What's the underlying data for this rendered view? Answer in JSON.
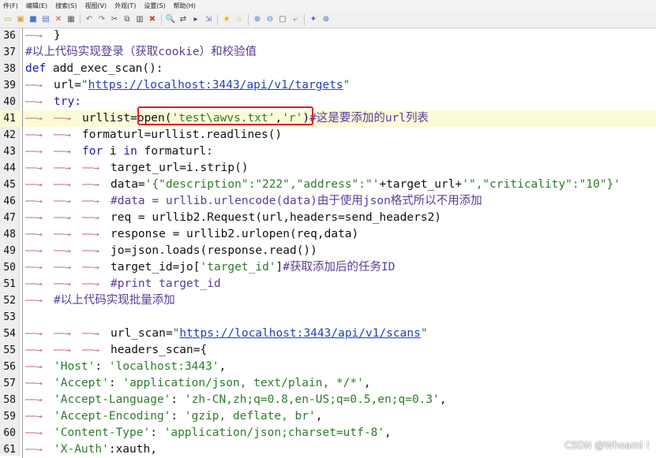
{
  "menubar": {
    "items": [
      "件(F)",
      "编辑(E)",
      "搜索(S)",
      "视图(V)",
      "外观(T)",
      "设置(S)",
      "帮助(H)"
    ]
  },
  "toolbar": {
    "icons": [
      "new-icon",
      "open-icon",
      "save-icon",
      "saveall-icon",
      "close-icon",
      "print-icon",
      "undo-icon",
      "redo-icon",
      "cut-icon",
      "copy-icon",
      "paste-icon",
      "delete-icon",
      "find-icon",
      "replace-icon",
      "findnext-icon",
      "goto-icon",
      "bookmark-icon",
      "bookmark-next-icon",
      "zoom-in-icon",
      "zoom-out-icon",
      "fullscreen-icon",
      "wrap-icon",
      "pin-icon",
      "plugin-icon"
    ]
  },
  "editor": {
    "lines": [
      {
        "n": "36",
        "segs": [
          {
            "t": "↦",
            "c": "tab"
          },
          {
            "t": "}",
            "c": ""
          }
        ]
      },
      {
        "n": "37",
        "segs": [
          {
            "t": "#以上代码实现登录（获取cookie）和校验值",
            "c": "cm"
          }
        ]
      },
      {
        "n": "38",
        "segs": [
          {
            "t": "def ",
            "c": "def"
          },
          {
            "t": "add_exec_scan():",
            "c": ""
          }
        ]
      },
      {
        "n": "39",
        "segs": [
          {
            "t": "↦",
            "c": "tab"
          },
          {
            "t": "url=",
            "c": ""
          },
          {
            "t": "\"",
            "c": "str"
          },
          {
            "t": "https://localhost:3443/api/v1/targets",
            "c": "url"
          },
          {
            "t": "\"",
            "c": "str"
          }
        ]
      },
      {
        "n": "40",
        "segs": [
          {
            "t": "↦",
            "c": "tab"
          },
          {
            "t": "try:",
            "c": "kw"
          }
        ]
      },
      {
        "n": "41",
        "segs": [
          {
            "t": "↦",
            "c": "tab"
          },
          {
            "t": "↦",
            "c": "tab"
          },
          {
            "t": "urllist=open(",
            "c": ""
          },
          {
            "t": "'test\\awvs.txt'",
            "c": "str"
          },
          {
            "t": ",",
            "c": ""
          },
          {
            "t": "'r'",
            "c": "str"
          },
          {
            "t": ")",
            "c": ""
          },
          {
            "t": "#这是要添加的url列表",
            "c": "cm"
          }
        ]
      },
      {
        "n": "42",
        "segs": [
          {
            "t": "↦",
            "c": "tab"
          },
          {
            "t": "↦",
            "c": "tab"
          },
          {
            "t": "formaturl=urllist.readlines()",
            "c": ""
          }
        ]
      },
      {
        "n": "43",
        "segs": [
          {
            "t": "↦",
            "c": "tab"
          },
          {
            "t": "↦",
            "c": "tab"
          },
          {
            "t": "for ",
            "c": "kw"
          },
          {
            "t": "i ",
            "c": ""
          },
          {
            "t": "in ",
            "c": "kw"
          },
          {
            "t": "formaturl:",
            "c": ""
          }
        ]
      },
      {
        "n": "44",
        "segs": [
          {
            "t": "↦",
            "c": "tab"
          },
          {
            "t": "↦",
            "c": "tab"
          },
          {
            "t": "↦",
            "c": "tab"
          },
          {
            "t": "target_url=i.strip()",
            "c": ""
          }
        ]
      },
      {
        "n": "45",
        "segs": [
          {
            "t": "↦",
            "c": "tab"
          },
          {
            "t": "↦",
            "c": "tab"
          },
          {
            "t": "↦",
            "c": "tab"
          },
          {
            "t": "data=",
            "c": ""
          },
          {
            "t": "'{\"description\":\"222\",\"address\":\"'",
            "c": "str"
          },
          {
            "t": "+target_url+",
            "c": ""
          },
          {
            "t": "'\",\"criticality\":\"10\"}'",
            "c": "str"
          }
        ]
      },
      {
        "n": "46",
        "segs": [
          {
            "t": "↦",
            "c": "tab"
          },
          {
            "t": "↦",
            "c": "tab"
          },
          {
            "t": "↦",
            "c": "tab"
          },
          {
            "t": "#data = urllib.urlencode(data)由于使用json格式所以不用添加",
            "c": "cm"
          }
        ]
      },
      {
        "n": "47",
        "segs": [
          {
            "t": "↦",
            "c": "tab"
          },
          {
            "t": "↦",
            "c": "tab"
          },
          {
            "t": "↦",
            "c": "tab"
          },
          {
            "t": "req = urllib2.Request(url,headers=send_headers2)",
            "c": ""
          }
        ]
      },
      {
        "n": "48",
        "segs": [
          {
            "t": "↦",
            "c": "tab"
          },
          {
            "t": "↦",
            "c": "tab"
          },
          {
            "t": "↦",
            "c": "tab"
          },
          {
            "t": "response = urllib2.urlopen(req,data)",
            "c": ""
          }
        ]
      },
      {
        "n": "49",
        "segs": [
          {
            "t": "↦",
            "c": "tab"
          },
          {
            "t": "↦",
            "c": "tab"
          },
          {
            "t": "↦",
            "c": "tab"
          },
          {
            "t": "jo=json.loads(response.read())",
            "c": ""
          }
        ]
      },
      {
        "n": "50",
        "segs": [
          {
            "t": "↦",
            "c": "tab"
          },
          {
            "t": "↦",
            "c": "tab"
          },
          {
            "t": "↦",
            "c": "tab"
          },
          {
            "t": "target_id=jo[",
            "c": ""
          },
          {
            "t": "'target_id'",
            "c": "str"
          },
          {
            "t": "]",
            "c": ""
          },
          {
            "t": "#获取添加后的任务ID",
            "c": "cm"
          }
        ]
      },
      {
        "n": "51",
        "segs": [
          {
            "t": "↦",
            "c": "tab"
          },
          {
            "t": "↦",
            "c": "tab"
          },
          {
            "t": "↦",
            "c": "tab"
          },
          {
            "t": "#print target_id",
            "c": "cm"
          }
        ]
      },
      {
        "n": "52",
        "segs": [
          {
            "t": "↦",
            "c": "tab"
          },
          {
            "t": "#以上代码实现批量添加",
            "c": "cm"
          }
        ]
      },
      {
        "n": "53",
        "segs": []
      },
      {
        "n": "54",
        "segs": [
          {
            "t": "↦",
            "c": "tab"
          },
          {
            "t": "↦",
            "c": "tab"
          },
          {
            "t": "↦",
            "c": "tab"
          },
          {
            "t": "url_scan=",
            "c": ""
          },
          {
            "t": "\"",
            "c": "str"
          },
          {
            "t": "https://localhost:3443/api/v1/scans",
            "c": "url"
          },
          {
            "t": "\"",
            "c": "str"
          }
        ]
      },
      {
        "n": "55",
        "segs": [
          {
            "t": "↦",
            "c": "tab"
          },
          {
            "t": "↦",
            "c": "tab"
          },
          {
            "t": "↦",
            "c": "tab"
          },
          {
            "t": "headers_scan={",
            "c": ""
          }
        ]
      },
      {
        "n": "56",
        "segs": [
          {
            "t": "↦",
            "c": "tab"
          },
          {
            "t": "'Host'",
            "c": "str"
          },
          {
            "t": ": ",
            "c": ""
          },
          {
            "t": "'localhost:3443'",
            "c": "str"
          },
          {
            "t": ",",
            "c": ""
          }
        ]
      },
      {
        "n": "57",
        "segs": [
          {
            "t": "↦",
            "c": "tab"
          },
          {
            "t": "'Accept'",
            "c": "str"
          },
          {
            "t": ": ",
            "c": ""
          },
          {
            "t": "'application/json, text/plain, */*'",
            "c": "str"
          },
          {
            "t": ",",
            "c": ""
          }
        ]
      },
      {
        "n": "58",
        "segs": [
          {
            "t": "↦",
            "c": "tab"
          },
          {
            "t": "'Accept-Language'",
            "c": "str"
          },
          {
            "t": ": ",
            "c": ""
          },
          {
            "t": "'zh-CN,zh;q=0.8,en-US;q=0.5,en;q=0.3'",
            "c": "str"
          },
          {
            "t": ",",
            "c": ""
          }
        ]
      },
      {
        "n": "59",
        "segs": [
          {
            "t": "↦",
            "c": "tab"
          },
          {
            "t": "'Accept-Encoding'",
            "c": "str"
          },
          {
            "t": ": ",
            "c": ""
          },
          {
            "t": "'gzip, deflate, br'",
            "c": "str"
          },
          {
            "t": ",",
            "c": ""
          }
        ]
      },
      {
        "n": "60",
        "segs": [
          {
            "t": "↦",
            "c": "tab"
          },
          {
            "t": "'Content-Type'",
            "c": "str"
          },
          {
            "t": ": ",
            "c": ""
          },
          {
            "t": "'application/json;charset=utf-8'",
            "c": "str"
          },
          {
            "t": ",",
            "c": ""
          }
        ]
      },
      {
        "n": "61",
        "segs": [
          {
            "t": "↦",
            "c": "tab"
          },
          {
            "t": "'X-Auth'",
            "c": "str"
          },
          {
            "t": ":xauth,",
            "c": ""
          }
        ]
      }
    ],
    "highlight_line": "41"
  },
  "watermark": "CSDN @Whoami !",
  "colors": {
    "highlight_box": "#e21f1f",
    "string": "#2e7a2e",
    "url": "#1f3fc4",
    "comment": "#5a3b9a",
    "keyword": "#1a1aa6"
  }
}
